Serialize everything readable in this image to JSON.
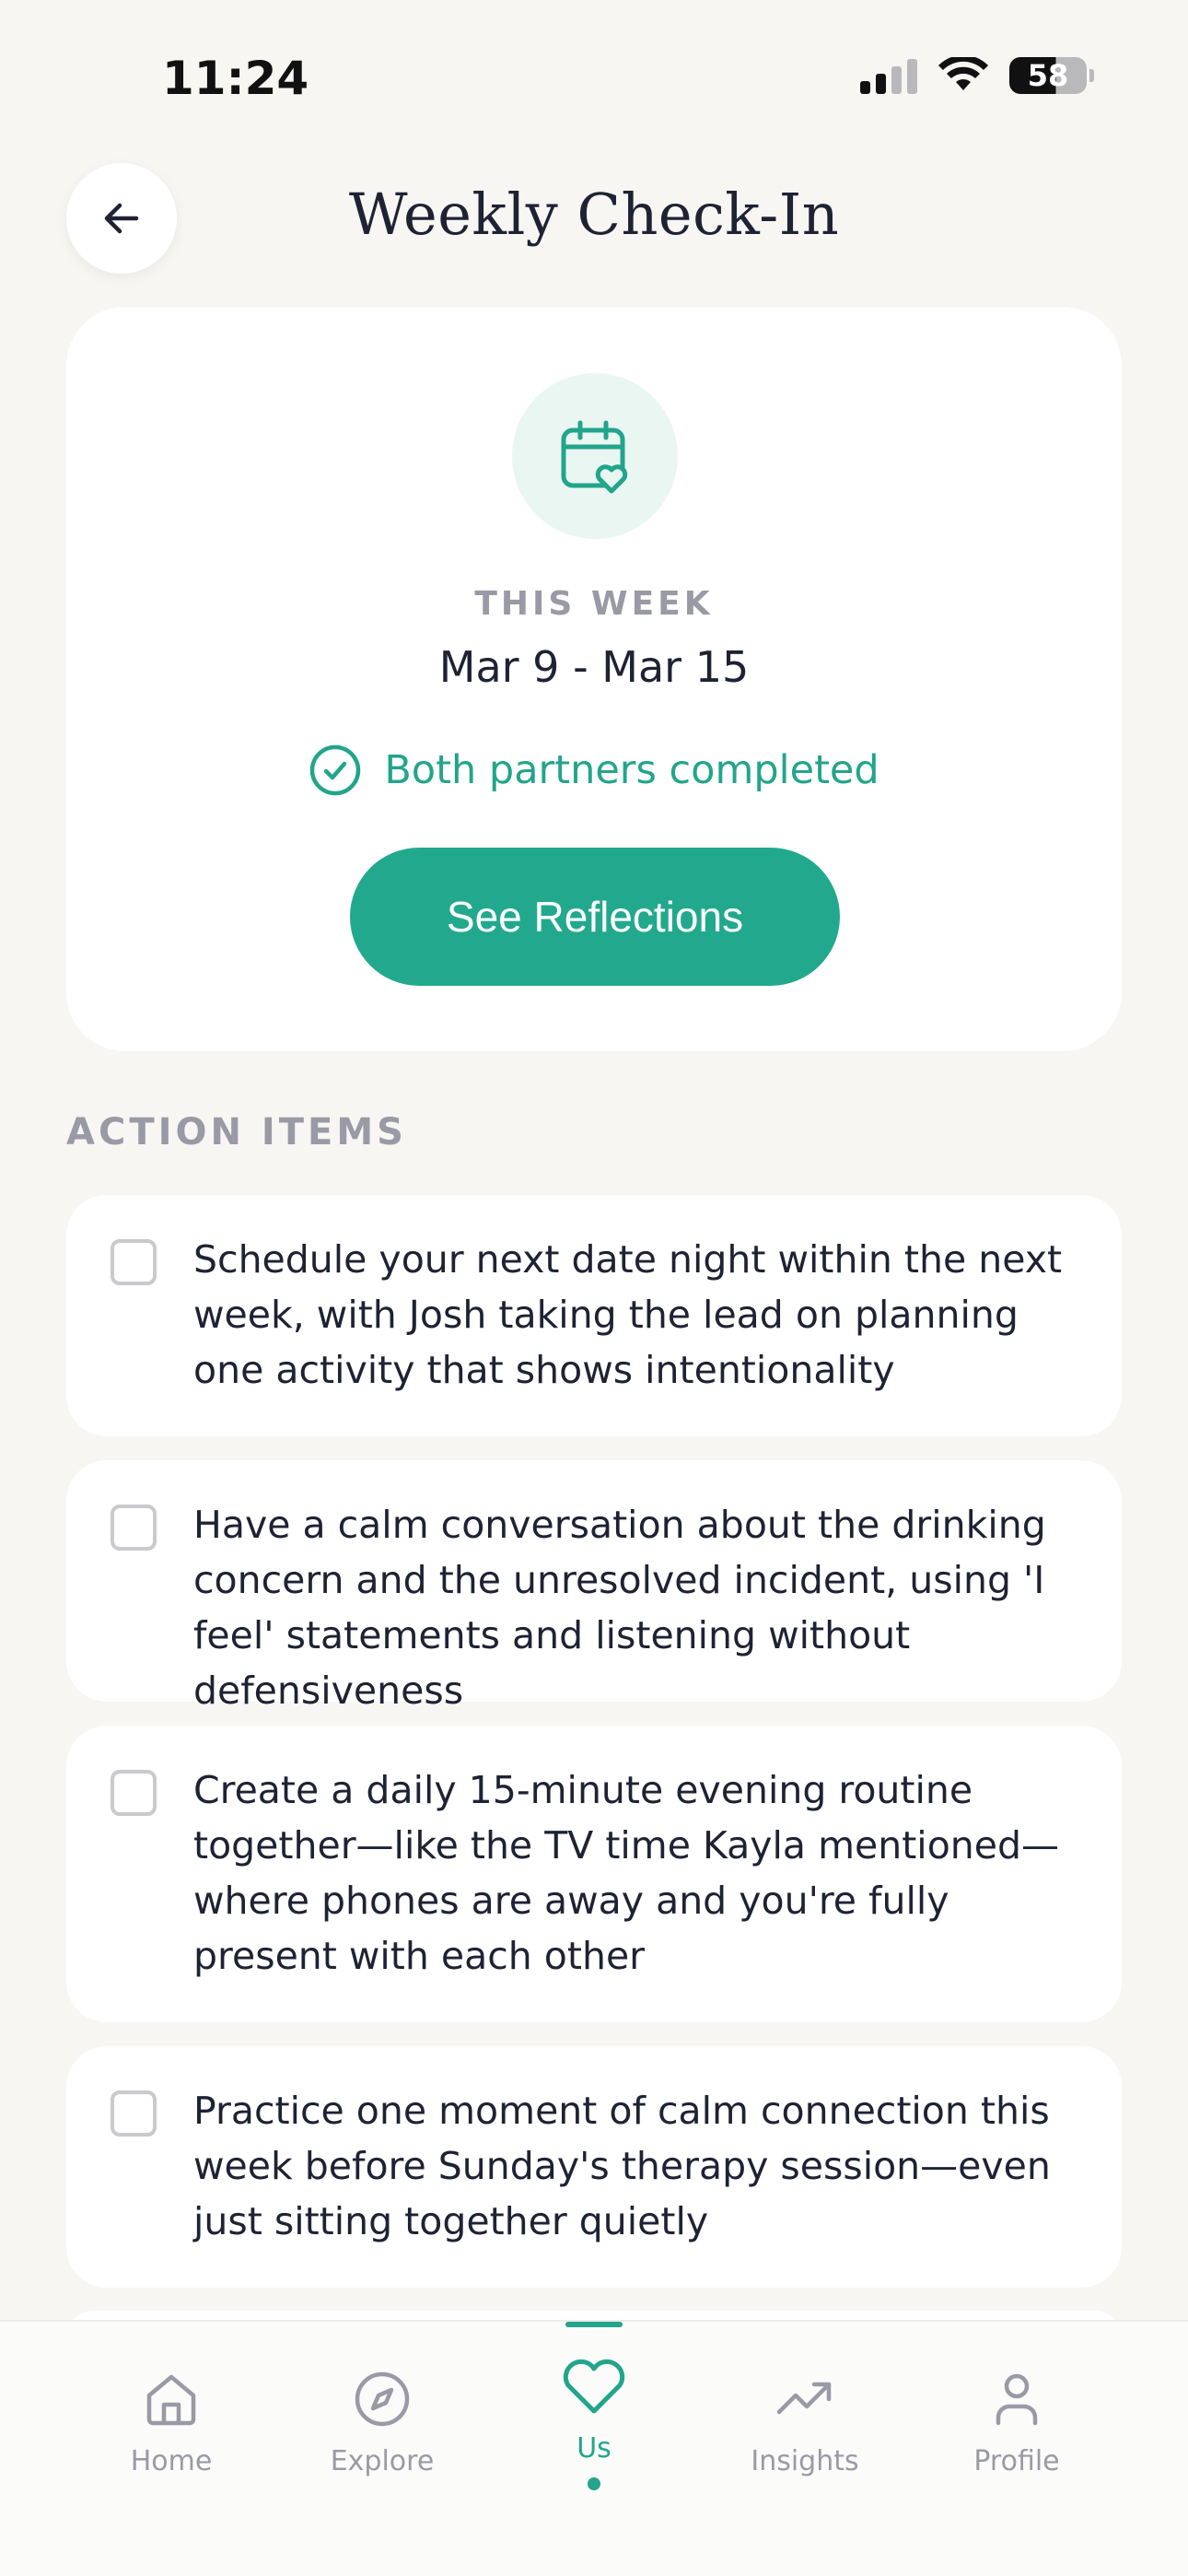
{
  "status_bar": {
    "time": "11:24",
    "battery": "58"
  },
  "header": {
    "title": "Weekly Check-In"
  },
  "summary": {
    "week_label": "THIS WEEK",
    "week_range": "Mar 9 - Mar 15",
    "status_text": "Both partners completed",
    "button_label": "See Reflections"
  },
  "action_items": {
    "section_label": "ACTION ITEMS",
    "items": [
      {
        "text": "Schedule your next date night within the next week, with Josh taking the lead on planning one activity that shows intentionality",
        "checked": false
      },
      {
        "text": "Have a calm conversation about the drinking concern and the unresolved incident, using 'I feel' statements and listening without defensiveness",
        "checked": false
      },
      {
        "text": "Create a daily 15-minute evening routine together—like the TV time Kayla mentioned—where phones are away and you're fully present with each other",
        "checked": false
      },
      {
        "text": "Practice one moment of calm connection this week before Sunday's therapy session—even just sitting together quietly",
        "checked": false
      }
    ]
  },
  "nav": {
    "items": [
      {
        "label": "Home",
        "icon": "home-icon"
      },
      {
        "label": "Explore",
        "icon": "compass-icon"
      },
      {
        "label": "Us",
        "icon": "heart-icon",
        "active": true
      },
      {
        "label": "Insights",
        "icon": "trending-up-icon"
      },
      {
        "label": "Profile",
        "icon": "person-icon"
      }
    ]
  },
  "colors": {
    "accent": "#22A98D",
    "background": "#F7F6F3",
    "card": "#FFFFFF",
    "muted": "#9A9AA6"
  }
}
